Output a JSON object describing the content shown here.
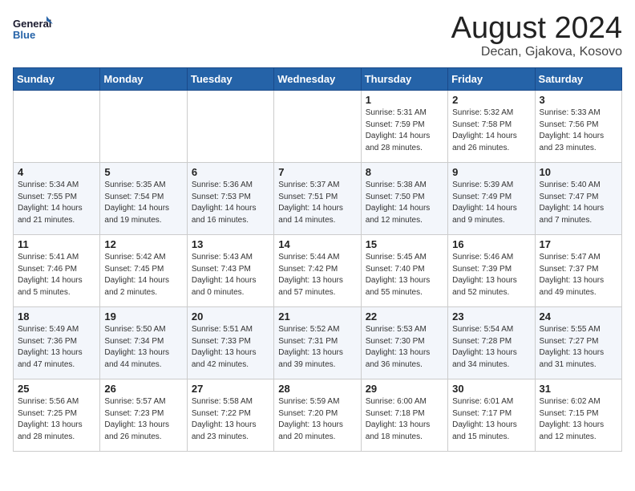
{
  "header": {
    "logo_general": "General",
    "logo_blue": "Blue",
    "month_year": "August 2024",
    "location": "Decan, Gjakova, Kosovo"
  },
  "days_of_week": [
    "Sunday",
    "Monday",
    "Tuesday",
    "Wednesday",
    "Thursday",
    "Friday",
    "Saturday"
  ],
  "weeks": [
    [
      {
        "day": "",
        "info": ""
      },
      {
        "day": "",
        "info": ""
      },
      {
        "day": "",
        "info": ""
      },
      {
        "day": "",
        "info": ""
      },
      {
        "day": "1",
        "info": "Sunrise: 5:31 AM\nSunset: 7:59 PM\nDaylight: 14 hours\nand 28 minutes."
      },
      {
        "day": "2",
        "info": "Sunrise: 5:32 AM\nSunset: 7:58 PM\nDaylight: 14 hours\nand 26 minutes."
      },
      {
        "day": "3",
        "info": "Sunrise: 5:33 AM\nSunset: 7:56 PM\nDaylight: 14 hours\nand 23 minutes."
      }
    ],
    [
      {
        "day": "4",
        "info": "Sunrise: 5:34 AM\nSunset: 7:55 PM\nDaylight: 14 hours\nand 21 minutes."
      },
      {
        "day": "5",
        "info": "Sunrise: 5:35 AM\nSunset: 7:54 PM\nDaylight: 14 hours\nand 19 minutes."
      },
      {
        "day": "6",
        "info": "Sunrise: 5:36 AM\nSunset: 7:53 PM\nDaylight: 14 hours\nand 16 minutes."
      },
      {
        "day": "7",
        "info": "Sunrise: 5:37 AM\nSunset: 7:51 PM\nDaylight: 14 hours\nand 14 minutes."
      },
      {
        "day": "8",
        "info": "Sunrise: 5:38 AM\nSunset: 7:50 PM\nDaylight: 14 hours\nand 12 minutes."
      },
      {
        "day": "9",
        "info": "Sunrise: 5:39 AM\nSunset: 7:49 PM\nDaylight: 14 hours\nand 9 minutes."
      },
      {
        "day": "10",
        "info": "Sunrise: 5:40 AM\nSunset: 7:47 PM\nDaylight: 14 hours\nand 7 minutes."
      }
    ],
    [
      {
        "day": "11",
        "info": "Sunrise: 5:41 AM\nSunset: 7:46 PM\nDaylight: 14 hours\nand 5 minutes."
      },
      {
        "day": "12",
        "info": "Sunrise: 5:42 AM\nSunset: 7:45 PM\nDaylight: 14 hours\nand 2 minutes."
      },
      {
        "day": "13",
        "info": "Sunrise: 5:43 AM\nSunset: 7:43 PM\nDaylight: 14 hours\nand 0 minutes."
      },
      {
        "day": "14",
        "info": "Sunrise: 5:44 AM\nSunset: 7:42 PM\nDaylight: 13 hours\nand 57 minutes."
      },
      {
        "day": "15",
        "info": "Sunrise: 5:45 AM\nSunset: 7:40 PM\nDaylight: 13 hours\nand 55 minutes."
      },
      {
        "day": "16",
        "info": "Sunrise: 5:46 AM\nSunset: 7:39 PM\nDaylight: 13 hours\nand 52 minutes."
      },
      {
        "day": "17",
        "info": "Sunrise: 5:47 AM\nSunset: 7:37 PM\nDaylight: 13 hours\nand 49 minutes."
      }
    ],
    [
      {
        "day": "18",
        "info": "Sunrise: 5:49 AM\nSunset: 7:36 PM\nDaylight: 13 hours\nand 47 minutes."
      },
      {
        "day": "19",
        "info": "Sunrise: 5:50 AM\nSunset: 7:34 PM\nDaylight: 13 hours\nand 44 minutes."
      },
      {
        "day": "20",
        "info": "Sunrise: 5:51 AM\nSunset: 7:33 PM\nDaylight: 13 hours\nand 42 minutes."
      },
      {
        "day": "21",
        "info": "Sunrise: 5:52 AM\nSunset: 7:31 PM\nDaylight: 13 hours\nand 39 minutes."
      },
      {
        "day": "22",
        "info": "Sunrise: 5:53 AM\nSunset: 7:30 PM\nDaylight: 13 hours\nand 36 minutes."
      },
      {
        "day": "23",
        "info": "Sunrise: 5:54 AM\nSunset: 7:28 PM\nDaylight: 13 hours\nand 34 minutes."
      },
      {
        "day": "24",
        "info": "Sunrise: 5:55 AM\nSunset: 7:27 PM\nDaylight: 13 hours\nand 31 minutes."
      }
    ],
    [
      {
        "day": "25",
        "info": "Sunrise: 5:56 AM\nSunset: 7:25 PM\nDaylight: 13 hours\nand 28 minutes."
      },
      {
        "day": "26",
        "info": "Sunrise: 5:57 AM\nSunset: 7:23 PM\nDaylight: 13 hours\nand 26 minutes."
      },
      {
        "day": "27",
        "info": "Sunrise: 5:58 AM\nSunset: 7:22 PM\nDaylight: 13 hours\nand 23 minutes."
      },
      {
        "day": "28",
        "info": "Sunrise: 5:59 AM\nSunset: 7:20 PM\nDaylight: 13 hours\nand 20 minutes."
      },
      {
        "day": "29",
        "info": "Sunrise: 6:00 AM\nSunset: 7:18 PM\nDaylight: 13 hours\nand 18 minutes."
      },
      {
        "day": "30",
        "info": "Sunrise: 6:01 AM\nSunset: 7:17 PM\nDaylight: 13 hours\nand 15 minutes."
      },
      {
        "day": "31",
        "info": "Sunrise: 6:02 AM\nSunset: 7:15 PM\nDaylight: 13 hours\nand 12 minutes."
      }
    ]
  ]
}
